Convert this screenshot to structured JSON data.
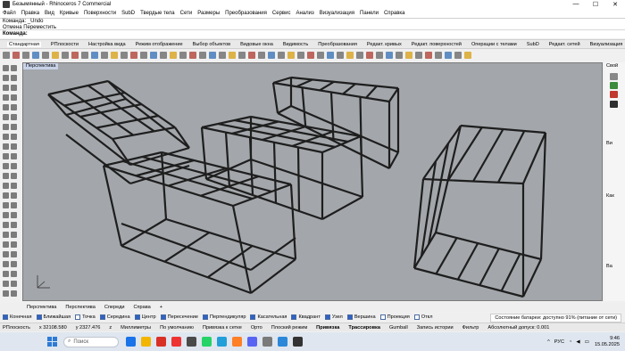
{
  "window": {
    "title": "Безымянный - Rhinoceros 7 Commercial",
    "controls": [
      "—",
      "☐",
      "✕"
    ]
  },
  "menu": [
    "Файл",
    "Правка",
    "Вид",
    "Кривые",
    "Поверхности",
    "SubD",
    "Твердые тела",
    "Сети",
    "Размеры",
    "Преобразования",
    "Сервис",
    "Анализ",
    "Визуализация",
    "Панели",
    "Справка"
  ],
  "history": [
    "Команда: _Undo",
    "Отмена Переместить"
  ],
  "command": {
    "label": "Команда:",
    "value": ""
  },
  "toolbar_tabs": [
    "Стандартная",
    "РПлоскости",
    "Настройка вида",
    "Режим отображение",
    "Выбор объектов",
    "Видовые окна",
    "Видимость",
    "Преобразования",
    "Редакт. кривых",
    "Редакт. поверхностей",
    "Операции с телами",
    "SubD",
    "Редакт. сетей",
    "Визуализация"
  ],
  "viewport": {
    "name": "Перспектива",
    "background": "#a3a7ab"
  },
  "right_panel": {
    "labels": [
      "Свой",
      "Ви",
      "Как",
      "Ba"
    ]
  },
  "view_tabs": [
    "Перспектива",
    "Перспектива",
    "Спереди",
    "Справа",
    "+"
  ],
  "osnaps": [
    {
      "label": "Конечная",
      "on": true
    },
    {
      "label": "Ближайшая",
      "on": true
    },
    {
      "label": "Точка",
      "on": false
    },
    {
      "label": "Середина",
      "on": true
    },
    {
      "label": "Центр",
      "on": true
    },
    {
      "label": "Пересечение",
      "on": true
    },
    {
      "label": "Перпендикуляр",
      "on": true
    },
    {
      "label": "Касательная",
      "on": true
    },
    {
      "label": "Квадрант",
      "on": true
    },
    {
      "label": "Узел",
      "on": true
    },
    {
      "label": "Вершина",
      "on": true
    },
    {
      "label": "Проекция",
      "on": false
    },
    {
      "label": "Откл",
      "on": false
    }
  ],
  "battery_tip": "Состояние батареи: доступно 91% (питание от сети)",
  "status": {
    "cplane": "РПлоскость",
    "x": "x 32108.580",
    "y": "y 2327.476",
    "z": "z",
    "units": "Миллиметры",
    "layer": "По умолчанию",
    "items": [
      "Привязка к сетке",
      "Орто",
      "Плоский режим",
      "Привязка",
      "Трассировка",
      "Gumball",
      "Запись истории",
      "Фильтр",
      "Абсолютный допуск: 0.001"
    ]
  },
  "taskbar": {
    "search_placeholder": "Поиск",
    "lang": "РУС",
    "time": "9:46",
    "date": "15.05.2025",
    "app_colors": [
      "#1a73e8",
      "#f2b600",
      "#d93025",
      "#e33",
      "#4a4a4a",
      "#25d366",
      "#229ed9",
      "#ff7f27",
      "#5865f2",
      "#7a7a7a",
      "#2b88d8",
      "#333333"
    ]
  }
}
